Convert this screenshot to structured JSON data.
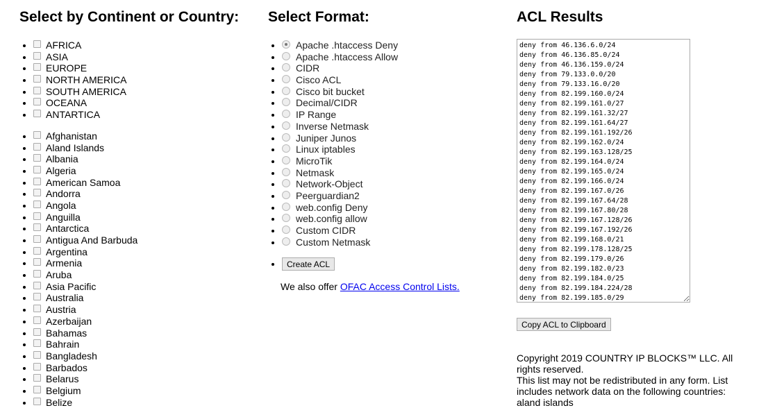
{
  "left": {
    "title": "Select by Continent or Country:",
    "continents": [
      "AFRICA",
      "ASIA",
      "EUROPE",
      "NORTH AMERICA",
      "SOUTH AMERICA",
      "OCEANA",
      "ANTARTICA"
    ],
    "countries": [
      "Afghanistan",
      "Aland Islands",
      "Albania",
      "Algeria",
      "American Samoa",
      "Andorra",
      "Angola",
      "Anguilla",
      "Antarctica",
      "Antigua And Barbuda",
      "Argentina",
      "Armenia",
      "Aruba",
      "Asia Pacific",
      "Australia",
      "Austria",
      "Azerbaijan",
      "Bahamas",
      "Bahrain",
      "Bangladesh",
      "Barbados",
      "Belarus",
      "Belgium",
      "Belize"
    ]
  },
  "middle": {
    "title": "Select Format:",
    "formats": [
      "Apache .htaccess Deny",
      "Apache .htaccess Allow",
      "CIDR",
      "Cisco ACL",
      "Cisco bit bucket",
      "Decimal/CIDR",
      "IP Range",
      "Inverse Netmask",
      "Juniper Junos",
      "Linux iptables",
      "MicroTik",
      "Netmask",
      "Network-Object",
      "Peerguardian2",
      "web.config Deny",
      "web.config allow",
      "Custom CIDR",
      "Custom Netmask"
    ],
    "selected": "Apache .htaccess Deny",
    "create_label": "Create ACL",
    "offer_text": "We also offer ",
    "offer_link": "OFAC Access Control Lists."
  },
  "right": {
    "title": "ACL Results",
    "results": "deny from 46.136.6.0/24\ndeny from 46.136.85.0/24\ndeny from 46.136.159.0/24\ndeny from 79.133.0.0/20\ndeny from 79.133.16.0/20\ndeny from 82.199.160.0/24\ndeny from 82.199.161.0/27\ndeny from 82.199.161.32/27\ndeny from 82.199.161.64/27\ndeny from 82.199.161.192/26\ndeny from 82.199.162.0/24\ndeny from 82.199.163.128/25\ndeny from 82.199.164.0/24\ndeny from 82.199.165.0/24\ndeny from 82.199.166.0/24\ndeny from 82.199.167.0/26\ndeny from 82.199.167.64/28\ndeny from 82.199.167.80/28\ndeny from 82.199.167.128/26\ndeny from 82.199.167.192/26\ndeny from 82.199.168.0/21\ndeny from 82.199.178.128/25\ndeny from 82.199.179.0/26\ndeny from 82.199.182.0/23\ndeny from 82.199.184.0/25\ndeny from 82.199.184.224/28\ndeny from 82.199.185.0/29",
    "copy_label": "Copy ACL to Clipboard",
    "copyright": "Copyright 2019 COUNTRY IP BLOCKS™ LLC. All rights reserved.",
    "notice": "This list may not be redistributed in any form. List includes network data on the following countries:",
    "countries_included": "aland islands"
  }
}
